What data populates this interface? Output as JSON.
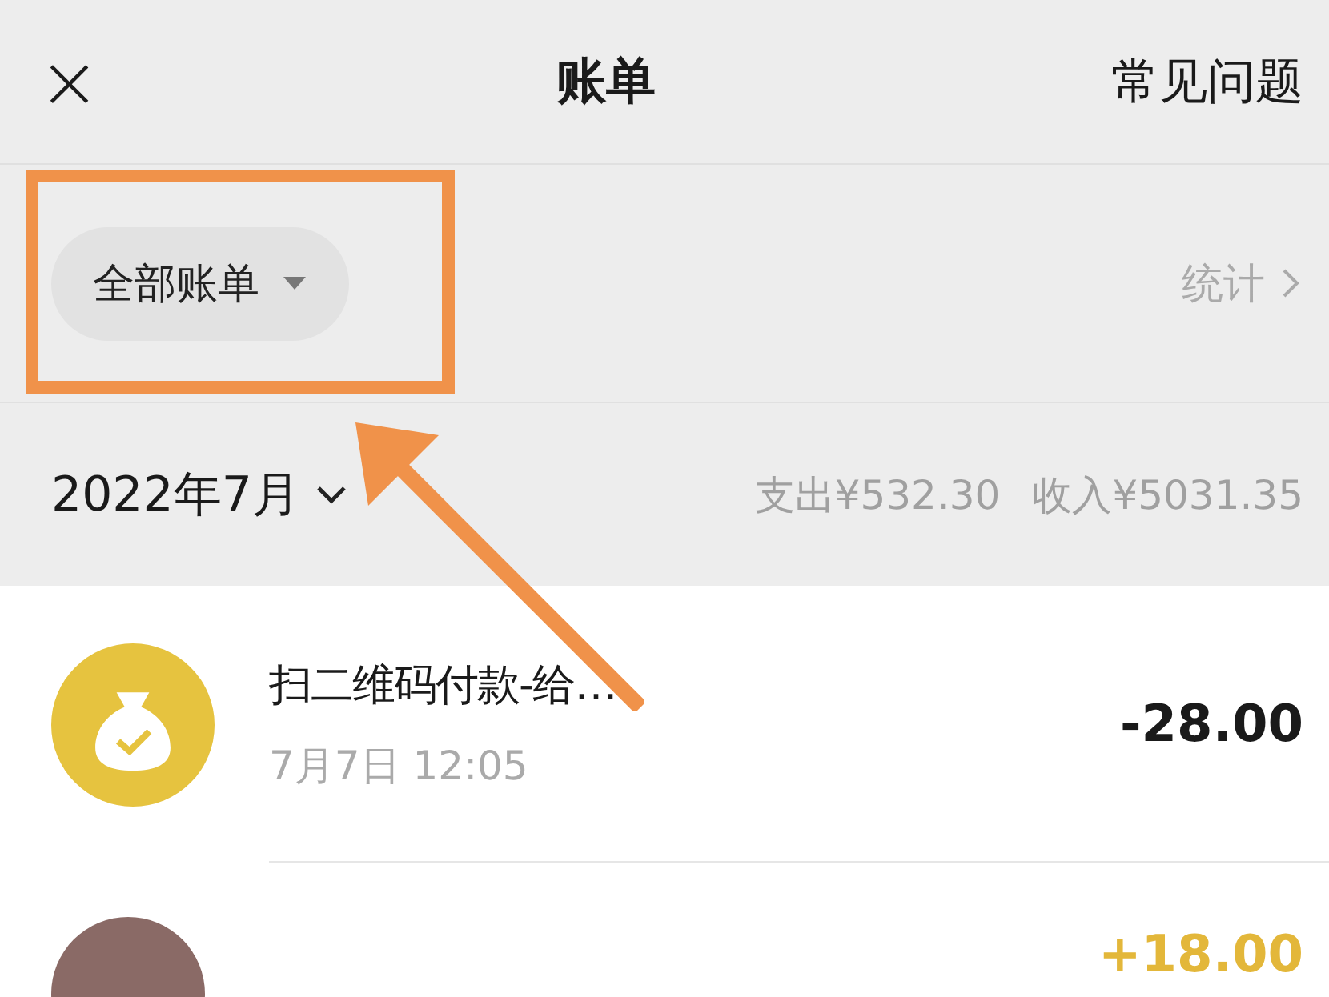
{
  "header": {
    "close": "×",
    "title": "账单",
    "faq": "常见问题"
  },
  "filter": {
    "label": "全部账单",
    "stats": "统计"
  },
  "month": {
    "label": "2022年7月",
    "expense": "支出¥532.30",
    "income": "收入¥5031.35"
  },
  "transactions": [
    {
      "kind": "icon",
      "title": "扫二维码付款-给…",
      "time": "7月7日 12:05",
      "amount": "-28.00",
      "income": false
    },
    {
      "kind": "avatar",
      "amount": "+18.00",
      "income": true
    }
  ],
  "annotation": {
    "shown": true
  }
}
